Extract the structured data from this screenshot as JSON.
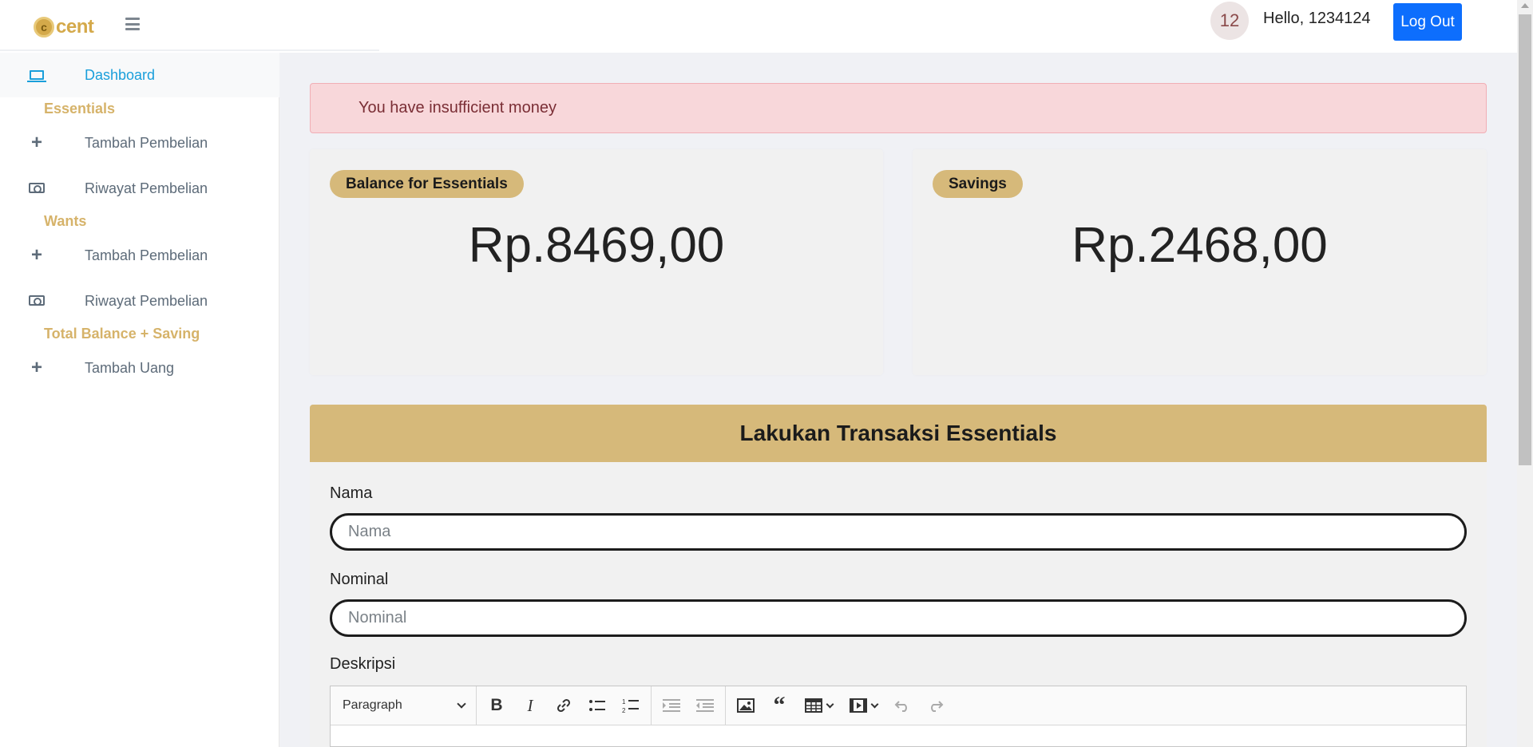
{
  "header": {
    "logo_symbol": "c",
    "logo_text": "cent",
    "notification_count": "12",
    "greeting": "Hello, 1234124",
    "logout_label": "Log Out"
  },
  "sidebar": {
    "dashboard": "Dashboard",
    "sections": {
      "essentials": "Essentials",
      "wants": "Wants",
      "total": "Total Balance + Saving"
    },
    "essentials_items": [
      "Tambah Pembelian",
      "Riwayat Pembelian"
    ],
    "wants_items": [
      "Tambah Pembelian",
      "Riwayat Pembelian"
    ],
    "total_items": [
      "Tambah Uang"
    ],
    "icons": {
      "dashboard": "laptop-icon",
      "add": "plus-icon",
      "history": "money-bill-icon"
    }
  },
  "alert": {
    "message": "You have insufficient money"
  },
  "cards": {
    "essentials": {
      "badge": "Balance for Essentials",
      "amount": "Rp.8469,00"
    },
    "savings": {
      "badge": "Savings",
      "amount": "Rp.2468,00"
    }
  },
  "form": {
    "title": "Lakukan Transaksi Essentials",
    "nama_label": "Nama",
    "nama_placeholder": "Nama",
    "nominal_label": "Nominal",
    "nominal_placeholder": "Nominal",
    "deskripsi_label": "Deskripsi",
    "editor": {
      "block_format": "Paragraph"
    }
  },
  "colors": {
    "accent_gold": "#d6b97a",
    "primary_blue": "#0d6efd",
    "active_link": "#1a9fdb",
    "alert_bg": "#f8d7da"
  }
}
